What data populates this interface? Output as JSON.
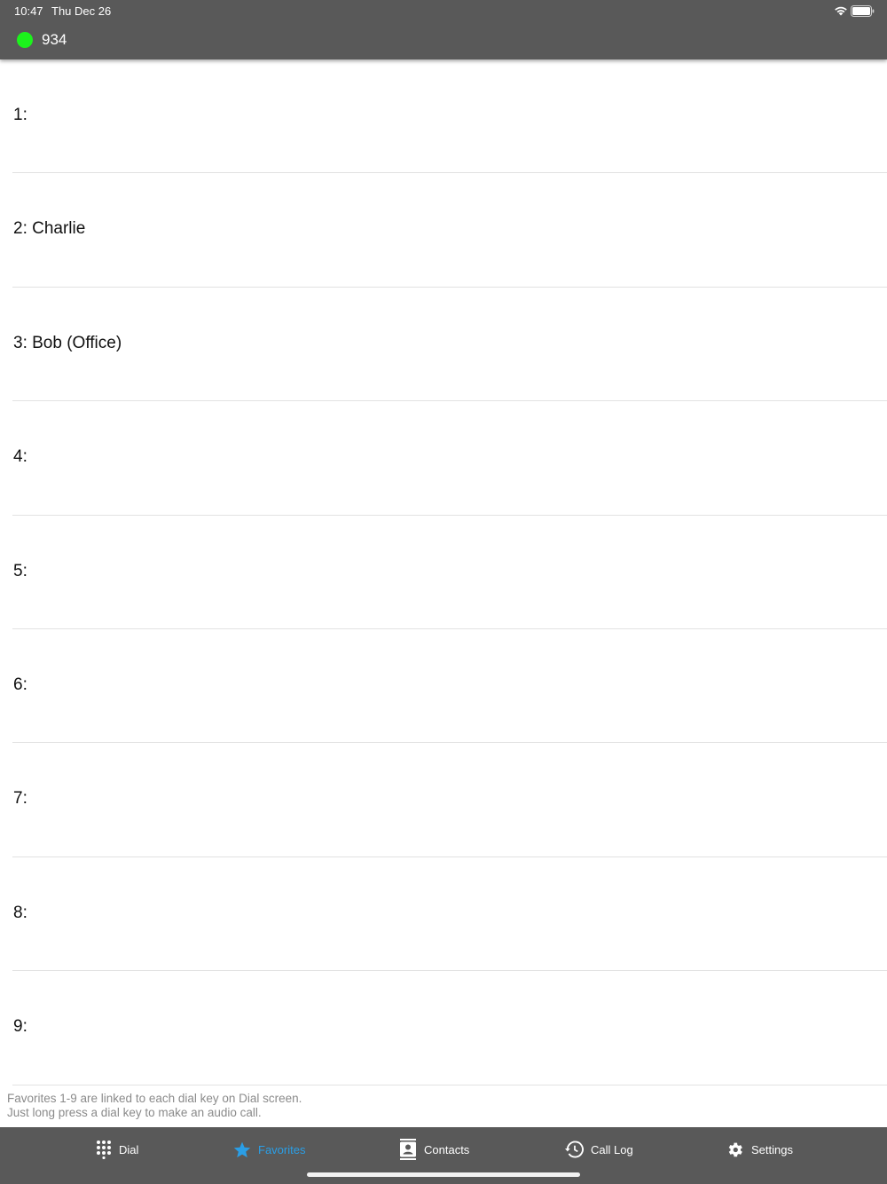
{
  "status_bar": {
    "time": "10:47",
    "date": "Thu Dec 26"
  },
  "account": {
    "number": "934",
    "status_color": "#1cf31c"
  },
  "favorites": [
    {
      "label": "1:"
    },
    {
      "label": "2: Charlie"
    },
    {
      "label": "3: Bob (Office)"
    },
    {
      "label": "4:"
    },
    {
      "label": "5:"
    },
    {
      "label": "6:"
    },
    {
      "label": "7:"
    },
    {
      "label": "8:"
    },
    {
      "label": "9:"
    }
  ],
  "note": {
    "line1": "Favorites 1-9 are linked to each dial key on Dial screen.",
    "line2": "Just long press a dial key to make an audio call."
  },
  "tabs": [
    {
      "label": "Dial",
      "icon": "dialpad-icon",
      "active": false
    },
    {
      "label": "Favorites",
      "icon": "star-icon",
      "active": true
    },
    {
      "label": "Contacts",
      "icon": "contacts-icon",
      "active": false
    },
    {
      "label": "Call Log",
      "icon": "history-icon",
      "active": false
    },
    {
      "label": "Settings",
      "icon": "gear-icon",
      "active": false
    }
  ],
  "colors": {
    "bar_background": "#595959",
    "active_tab": "#2a9ee6",
    "divider": "#e2e2e2"
  }
}
